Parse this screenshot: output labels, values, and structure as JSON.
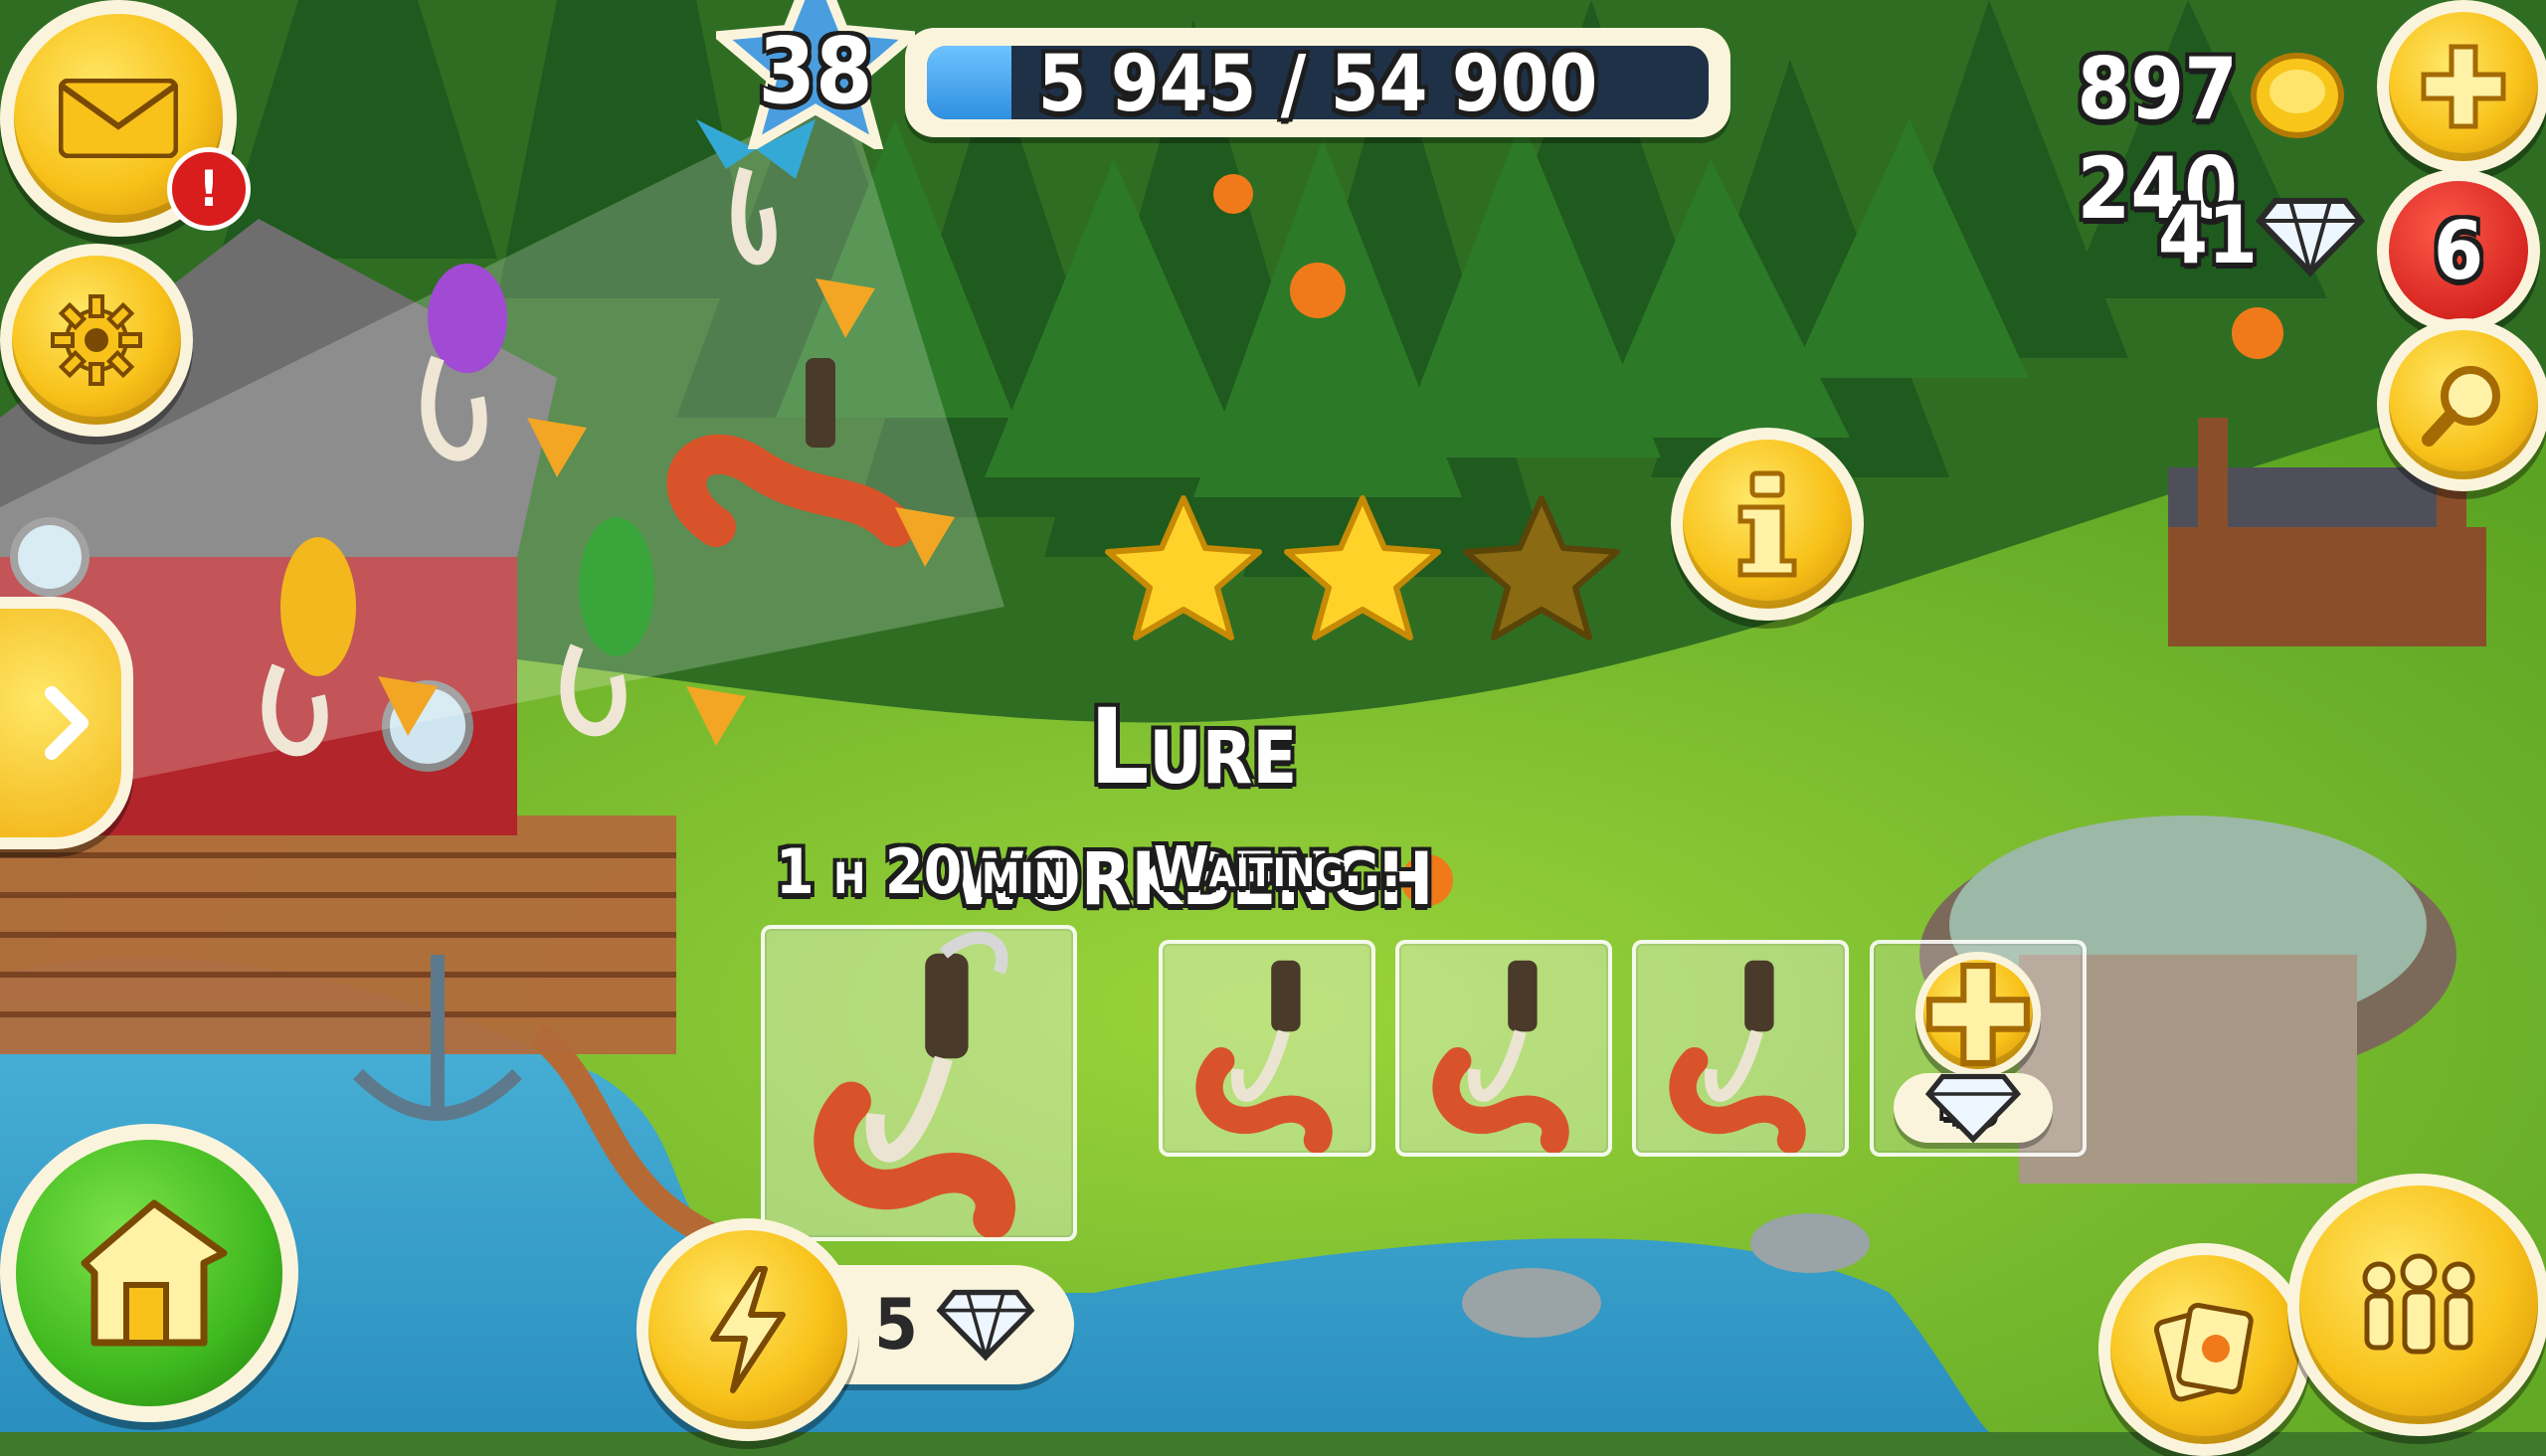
{
  "hud": {
    "level": "38",
    "xp_text": "5 945 / 54 900",
    "xp_progress": 0.108,
    "coins": "897 240",
    "diamonds": "41",
    "notification_count": "6",
    "mail_alert": "!"
  },
  "building": {
    "title": "Lure workbench",
    "stars_earned": 2,
    "stars_total": 3,
    "current_timer": "1 h 20 min",
    "queue_status": "Waiting...",
    "speedup_cost": "5",
    "new_slot_cost": "45"
  },
  "icons": {
    "mail": "envelope-icon",
    "settings": "gear-icon",
    "expand": "chevron-right-icon",
    "home": "house-icon",
    "speedup": "lightning-icon",
    "info": "info-icon",
    "add_currency": "plus-icon",
    "search": "magnifier-icon",
    "friends": "people-icon",
    "cards": "cards-icon",
    "diamond": "diamond-icon",
    "coin": "coin-icon"
  },
  "colors": {
    "gold_button": "#f8c21a",
    "home_button": "#3fb91f",
    "badge_red": "#d91c1c",
    "xp_blue": "#2f8fe0"
  }
}
